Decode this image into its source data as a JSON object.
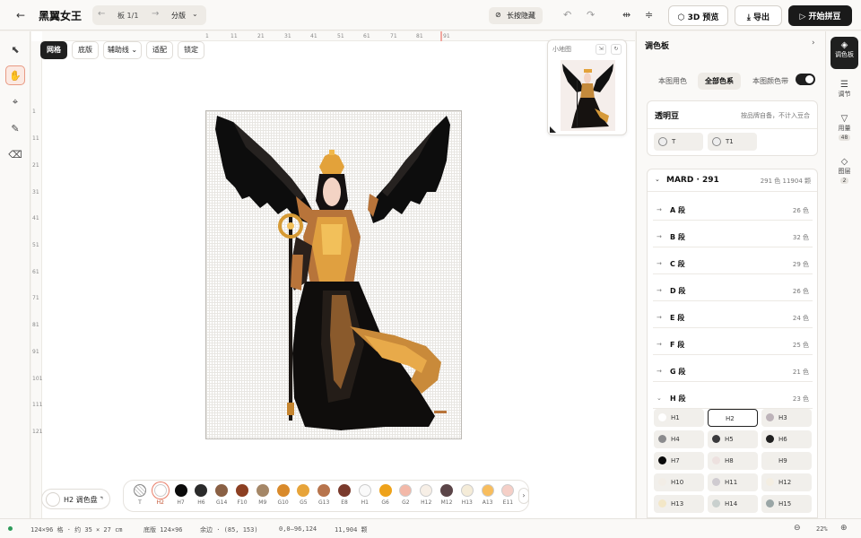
{
  "app": {
    "title": "黑翼女王"
  },
  "header": {
    "board_label": "板 1/1",
    "split_label": "分版",
    "hide_label": "长按隐藏",
    "preview_3d_label": "3D 预览",
    "export_label": "导出",
    "start_label": "开始拼豆",
    "start_color": "#1a1a1a"
  },
  "left_tools": [
    {
      "name": "select-tool",
      "icon": "⬉"
    },
    {
      "name": "hand-tool",
      "icon": "✋"
    },
    {
      "name": "crop-tool",
      "icon": "⌖"
    },
    {
      "name": "eyedropper-tool",
      "icon": "✎"
    },
    {
      "name": "eraser-tool",
      "icon": "⌫"
    }
  ],
  "canvas": {
    "view_buttons": [
      "网格",
      "底版",
      "辅助线",
      "适配",
      "锁定"
    ],
    "ruler_top": [
      "1",
      "11",
      "21",
      "31",
      "41",
      "51",
      "61",
      "71",
      "81",
      "91"
    ],
    "ruler_left": [
      "1",
      "11",
      "21",
      "31",
      "41",
      "51",
      "61",
      "71",
      "81",
      "91",
      "101",
      "111",
      "121"
    ],
    "minimap_title": "小地图",
    "current_color_label": "H2 调色盘"
  },
  "color_strip": [
    {
      "code": "T",
      "color": "transparent"
    },
    {
      "code": "H2",
      "color": "#ffffff"
    },
    {
      "code": "H7",
      "color": "#0b0b0b"
    },
    {
      "code": "H6",
      "color": "#2b2b2b"
    },
    {
      "code": "G14",
      "color": "#8a6044"
    },
    {
      "code": "F10",
      "color": "#8c3f22"
    },
    {
      "code": "M9",
      "color": "#a58767"
    },
    {
      "code": "G10",
      "color": "#d98a2b"
    },
    {
      "code": "G5",
      "color": "#e7a43a"
    },
    {
      "code": "G13",
      "color": "#b7744c"
    },
    {
      "code": "E8",
      "color": "#7a3a2c"
    },
    {
      "code": "H1",
      "color": "#fafafa"
    },
    {
      "code": "G6",
      "color": "#eea21a"
    },
    {
      "code": "G2",
      "color": "#f3b8a8"
    },
    {
      "code": "H12",
      "color": "#f7efe6"
    },
    {
      "code": "M12",
      "color": "#5b4548"
    },
    {
      "code": "H13",
      "color": "#f5ecd8"
    },
    {
      "code": "A13",
      "color": "#f8bd5d"
    },
    {
      "code": "E11",
      "color": "#f5cfc7"
    }
  ],
  "palette": {
    "title": "调色板",
    "tabs": [
      "本图用色",
      "全部色系",
      "本图颜色带"
    ],
    "transparent": {
      "title": "透明豆",
      "note": "按品牌自备，不计入豆合",
      "chips": [
        "T",
        "T1"
      ]
    },
    "brand": {
      "name": "MARD · 291",
      "stats": "291 色  11904 颗",
      "segments": [
        {
          "name": "A 段",
          "count": "26 色"
        },
        {
          "name": "B 段",
          "count": "32 色"
        },
        {
          "name": "C 段",
          "count": "29 色"
        },
        {
          "name": "D 段",
          "count": "26 色"
        },
        {
          "name": "E 段",
          "count": "24 色"
        },
        {
          "name": "F 段",
          "count": "25 色"
        },
        {
          "name": "G 段",
          "count": "21 色"
        },
        {
          "name": "H 段",
          "count": "23 色"
        }
      ],
      "h_colors": [
        {
          "code": "H1",
          "color": "#ffffff"
        },
        {
          "code": "H2",
          "color": "#ffffff"
        },
        {
          "code": "H3",
          "color": "#bdb3b9"
        },
        {
          "code": "H4",
          "color": "#8b8b8d"
        },
        {
          "code": "H5",
          "color": "#3a3a3c"
        },
        {
          "code": "H6",
          "color": "#202020"
        },
        {
          "code": "H7",
          "color": "#0a0a0a"
        },
        {
          "code": "H8",
          "color": "#ede1df"
        },
        {
          "code": "H9",
          "color": "#f1efea"
        },
        {
          "code": "H10",
          "color": "#f2ede6"
        },
        {
          "code": "H11",
          "color": "#cfcbd0"
        },
        {
          "code": "H12",
          "color": "#f4eee2"
        },
        {
          "code": "H13",
          "color": "#f3e7c7"
        },
        {
          "code": "H14",
          "color": "#c9d0ce"
        },
        {
          "code": "H15",
          "color": "#9aa6a6"
        }
      ]
    }
  },
  "right_rail": [
    {
      "label": "调色板",
      "icon": "◈",
      "badge": ""
    },
    {
      "label": "调节",
      "icon": "☰",
      "badge": ""
    },
    {
      "label": "用量",
      "icon": "▽",
      "badge": "48"
    },
    {
      "label": "图层",
      "icon": "◇",
      "badge": "2"
    }
  ],
  "status": {
    "size": "124×96 格 · 约 35 × 27 cm",
    "board": "底版 124×96",
    "margin": "余边 · (85, 153)",
    "range": "0,0–96,124",
    "beads": "11,904 颗",
    "zoom": "22%"
  }
}
